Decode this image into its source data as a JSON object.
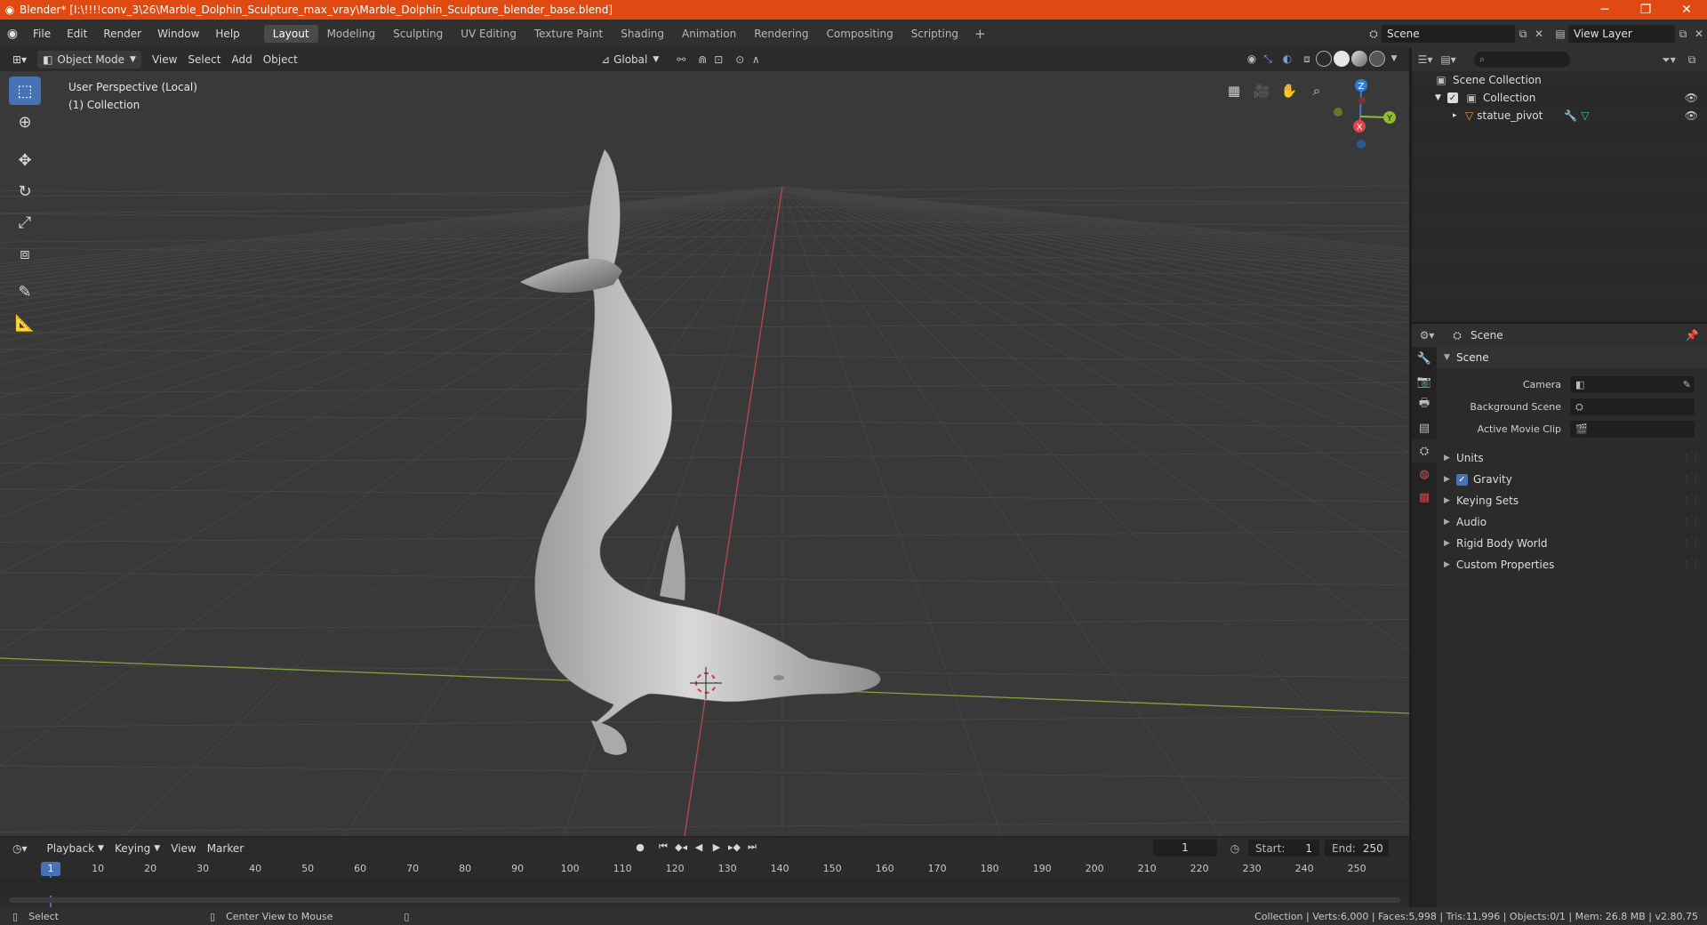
{
  "window": {
    "title": "Blender* [I:\\!!!!conv_3\\26\\Marble_Dolphin_Sculpture_max_vray\\Marble_Dolphin_Sculpture_blender_base.blend]",
    "minimize": "─",
    "maximize": "❐",
    "close": "✕"
  },
  "menu": [
    "File",
    "Edit",
    "Render",
    "Window",
    "Help"
  ],
  "workspaces": [
    "Layout",
    "Modeling",
    "Sculpting",
    "UV Editing",
    "Texture Paint",
    "Shading",
    "Animation",
    "Rendering",
    "Compositing",
    "Scripting"
  ],
  "active_workspace": "Layout",
  "scene_selector": "Scene",
  "view_layer": "View Layer",
  "viewport_header": {
    "mode": "Object Mode",
    "menus": [
      "View",
      "Select",
      "Add",
      "Object"
    ],
    "transform_orientation": "Global"
  },
  "viewport": {
    "perspective": "User Perspective (Local)",
    "collection": "(1) Collection",
    "axis_labels": {
      "z": "Z",
      "y": "Y",
      "x": "X"
    },
    "colors": {
      "x_axis": "#e0424e",
      "y_axis": "#8cbe2f",
      "z_axis": "#2f7fd6"
    }
  },
  "outliner": {
    "root": "Scene Collection",
    "collection": "Collection",
    "object": "statue_pivot"
  },
  "properties": {
    "context": "Scene",
    "panel": "Scene",
    "rows": [
      {
        "label": "Camera"
      },
      {
        "label": "Background Scene"
      },
      {
        "label": "Active Movie Clip"
      }
    ],
    "subpanels": [
      "Units",
      "Gravity",
      "Keying Sets",
      "Audio",
      "Rigid Body World",
      "Custom Properties"
    ],
    "gravity_enabled": true
  },
  "timeline": {
    "menus": [
      "Playback",
      "Keying",
      "View",
      "Marker"
    ],
    "current_frame": "1",
    "start_label": "Start:",
    "start": "1",
    "end_label": "End:",
    "end": "250",
    "ticks": [
      "10",
      "20",
      "30",
      "40",
      "50",
      "60",
      "70",
      "80",
      "90",
      "100",
      "110",
      "120",
      "130",
      "140",
      "150",
      "160",
      "170",
      "180",
      "190",
      "200",
      "210",
      "220",
      "230",
      "240",
      "250"
    ]
  },
  "statusbar": {
    "left1": "Select",
    "left2": "Center View to Mouse",
    "right": "Collection | Verts:6,000 | Faces:5,998 | Tris:11,996 | Objects:0/1 | Mem: 26.8 MB | v2.80.75"
  },
  "accent_color": "#4772b3"
}
